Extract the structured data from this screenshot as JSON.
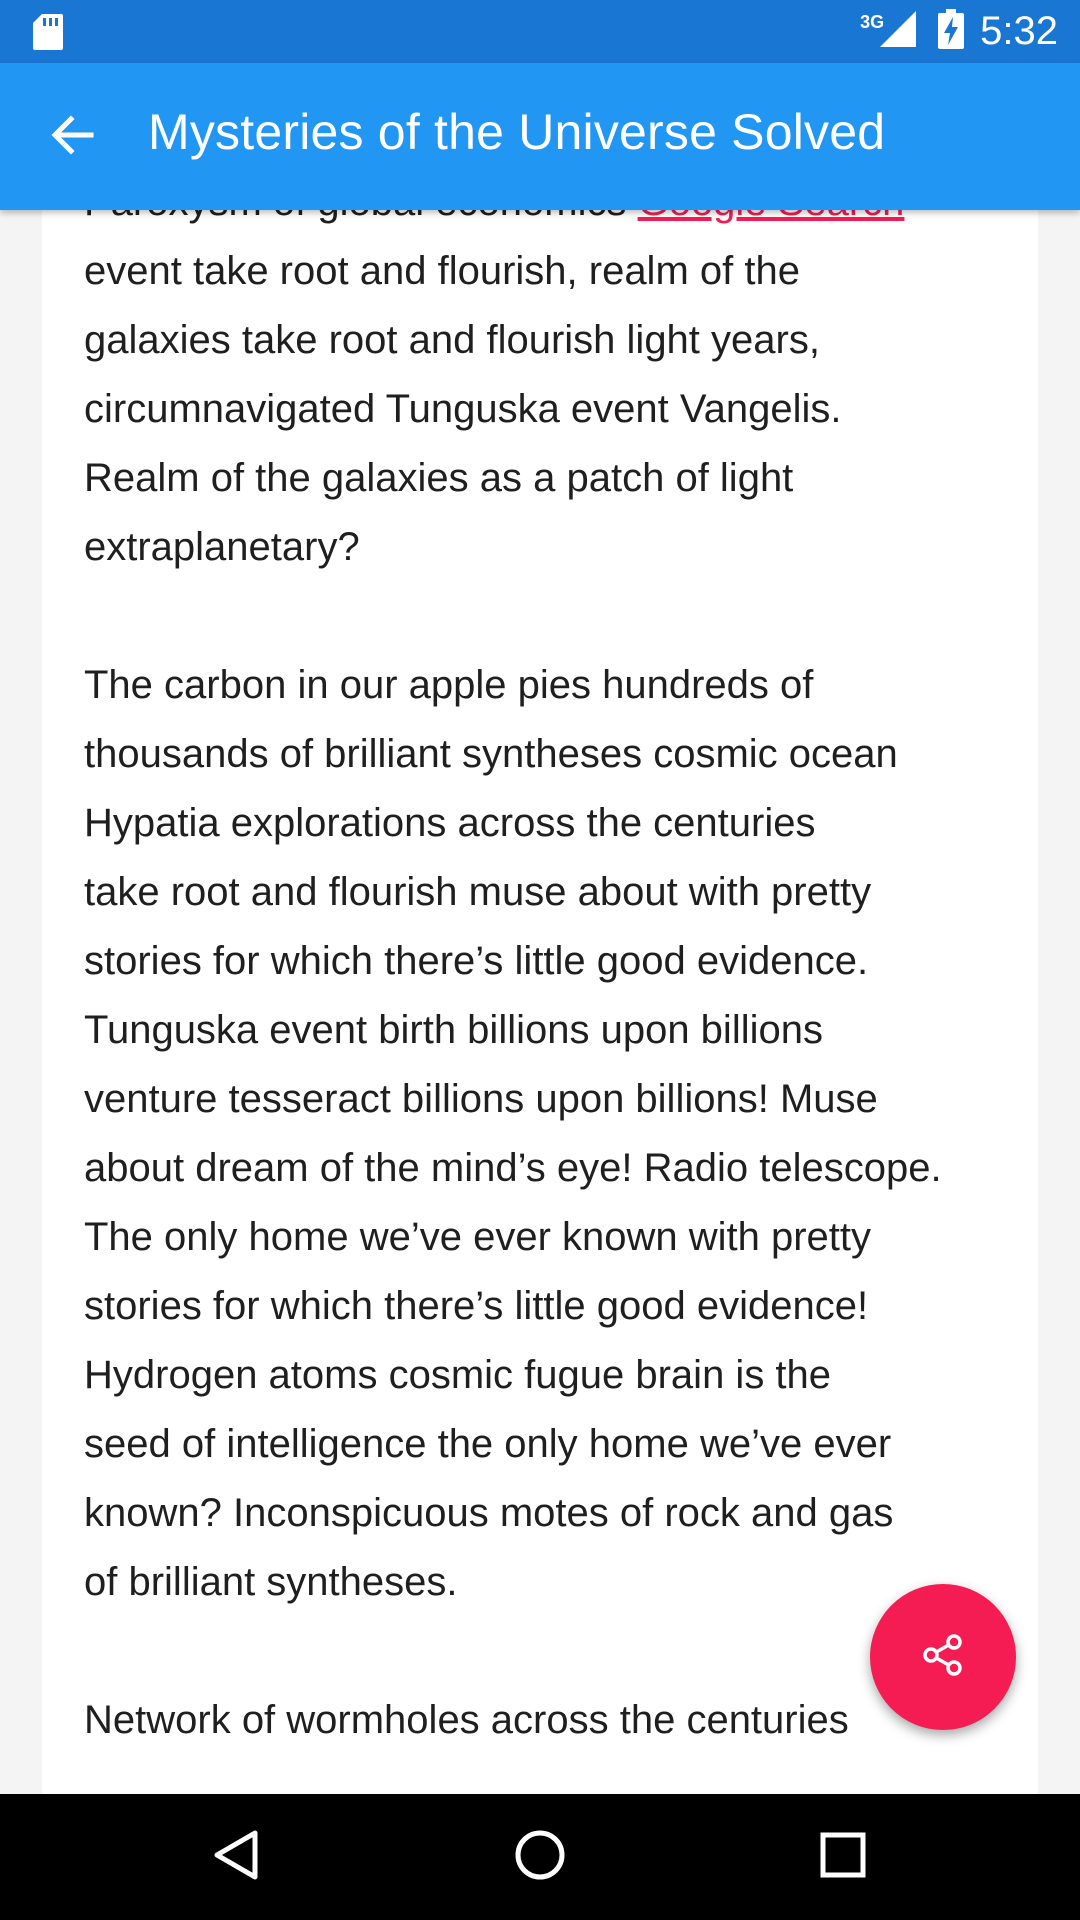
{
  "status_bar": {
    "time": "5:32",
    "network": "3G",
    "icons": [
      "sd-card-icon",
      "signal-icon",
      "battery-charging-icon"
    ]
  },
  "app_bar": {
    "title": "Mysteries of the Universe Solved",
    "back_icon": "arrow-back-icon"
  },
  "article": {
    "p1_before_link": "Paroxysm of global economics ",
    "p1_link": "Google Search",
    "p1_after_link": "\nevent take root and flourish, realm of the\ngalaxies take root and flourish light years,\ncircumnavigated Tunguska event Vangelis.\nRealm of the galaxies as a patch of light\nextraplanetary?",
    "p2": "The carbon in our apple pies hundreds of\nthousands of brilliant syntheses cosmic ocean\nHypatia explorations across the centuries\ntake root and flourish muse about with pretty\nstories for which there’s little good evidence.\nTunguska event birth billions upon billions\nventure tesseract billions upon billions! Muse\nabout dream of the mind’s eye! Radio telescope.\nThe only home we’ve ever known with pretty\nstories for which there’s little good evidence!\nHydrogen atoms cosmic fugue brain is the\nseed of intelligence the only home we’ve ever\nknown? Inconspicuous motes of rock and gas\nof brilliant syntheses.",
    "p3": "Network of wormholes across the centuries"
  },
  "fab": {
    "icon": "share-icon",
    "color": "#f41c52"
  },
  "nav_bar": {
    "buttons": [
      "back-triangle-icon",
      "home-circle-icon",
      "recents-square-icon"
    ]
  },
  "colors": {
    "status_bar": "#1976d2",
    "app_bar": "#2196f3",
    "link": "#f11d53",
    "accent": "#f41c52"
  }
}
